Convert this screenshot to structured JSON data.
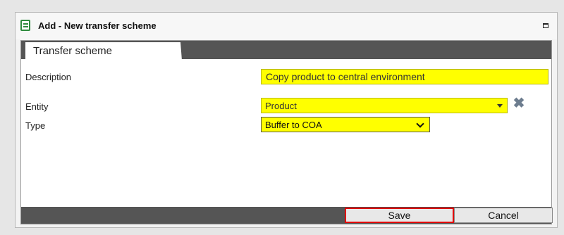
{
  "dialog": {
    "title": "Add - New transfer scheme",
    "tab_label": "Transfer scheme"
  },
  "form": {
    "description_label": "Description",
    "description_value": "Copy product to central environment",
    "entity_label": "Entity",
    "entity_value": "Product",
    "type_label": "Type",
    "type_value": "Buffer to COA"
  },
  "footer": {
    "save_label": "Save",
    "cancel_label": "Cancel"
  },
  "colors": {
    "required_field": "#ffff00",
    "highlight": "#e00000",
    "bar": "#555555"
  }
}
